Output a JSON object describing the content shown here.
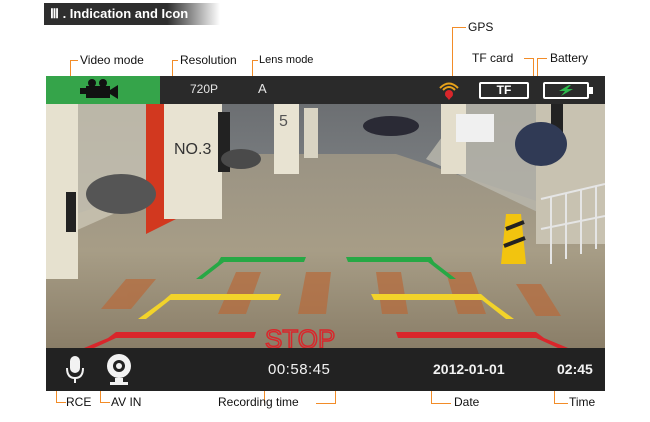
{
  "section_header": "Ⅲ . Indication and Icon",
  "callouts": {
    "gps": "GPS",
    "tf_card": "TF card",
    "battery": "Battery",
    "video_mode": "Video mode",
    "resolution": "Resolution",
    "lens_mode": "Lens mode",
    "rce": "RCE",
    "av_in": "AV IN",
    "recording_time": "Recording time",
    "date": "Date",
    "time": "Time"
  },
  "screen": {
    "resolution_value": "720P",
    "lens_value": "A",
    "tf_label": "TF",
    "recording_time_value": "00:58:45",
    "date_value": "2012-01-01",
    "time_value": "02:45",
    "stop_text": "STOP",
    "pillar_number_left": "NO.3",
    "pillar_number_right": "5"
  },
  "icons": {
    "video_mode": "video-camera-icon",
    "gps": "gps-signal-icon",
    "battery": "battery-charging-icon",
    "rce": "microphone-icon",
    "av_in": "webcam-icon"
  },
  "colors": {
    "accent_orange": "#f28c28",
    "video_tile_green": "#35a44a",
    "guide_green": "#27a845",
    "guide_yellow": "#f2d32a",
    "guide_red": "#d9262b"
  }
}
